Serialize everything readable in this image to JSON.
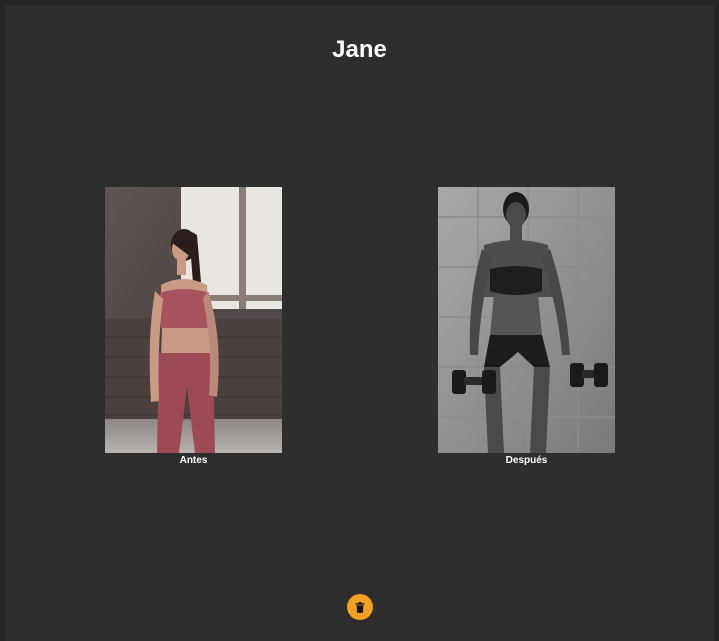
{
  "profile": {
    "name": "Jane"
  },
  "photos": {
    "before": {
      "caption": "Antes",
      "style": "color"
    },
    "after": {
      "caption": "Después",
      "style": "grayscale"
    }
  },
  "actions": {
    "delete_icon": "trash-icon"
  },
  "colors": {
    "background": "#2e2e2e",
    "text": "#ffffff",
    "accent": "#f5a01e"
  }
}
